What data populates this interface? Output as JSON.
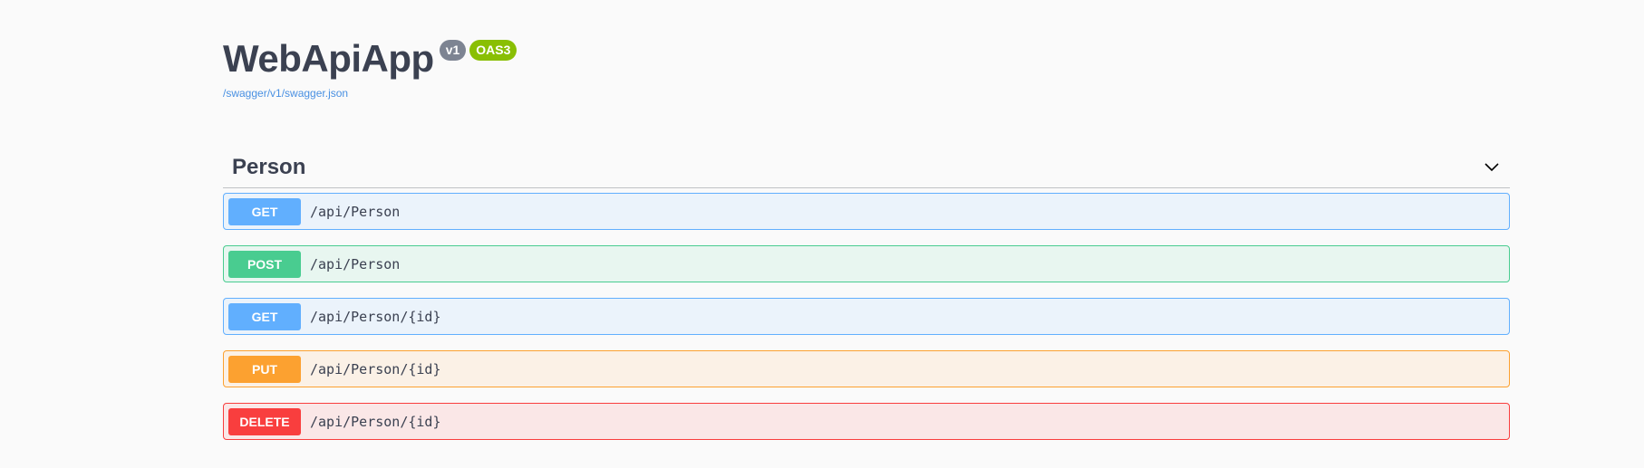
{
  "info": {
    "title": "WebApiApp",
    "version_badge": "v1",
    "oas_badge": "OAS3",
    "spec_link": "/swagger/v1/swagger.json"
  },
  "tag": {
    "name": "Person",
    "expanded_icon": "chevron-down-icon"
  },
  "operations": [
    {
      "method": "GET",
      "path": "/api/Person",
      "color": "#61affe",
      "bg": "#ebf3fb",
      "border": "#61affe"
    },
    {
      "method": "POST",
      "path": "/api/Person",
      "color": "#49cc90",
      "bg": "#e8f6f0",
      "border": "#49cc90"
    },
    {
      "method": "GET",
      "path": "/api/Person/{id}",
      "color": "#61affe",
      "bg": "#ebf3fb",
      "border": "#61affe"
    },
    {
      "method": "PUT",
      "path": "/api/Person/{id}",
      "color": "#fca130",
      "bg": "#fbf1e6",
      "border": "#fca130"
    },
    {
      "method": "DELETE",
      "path": "/api/Person/{id}",
      "color": "#f93e3e",
      "bg": "#fae7e7",
      "border": "#f93e3e"
    }
  ]
}
